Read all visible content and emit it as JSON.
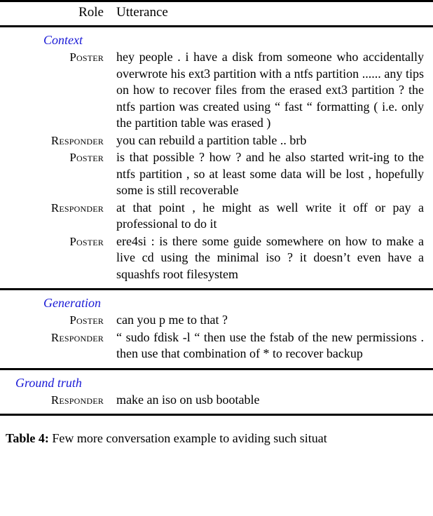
{
  "table": {
    "headers": {
      "role": "Role",
      "utterance": "Utterance"
    },
    "accent_color": "#1a1ad6",
    "sections": [
      {
        "label": "Context",
        "rows": [
          {
            "role": "Poster",
            "text": "hey people .  i have a disk from someone who accidentally overwrote his ext3 partition with a ntfs partition ...... any tips on how to recover files from the erased ext3 partition ?  the ntfs partion was created using “ fast “ formatting ( i.e.  only the partition table was erased )"
          },
          {
            "role": "Responder",
            "text": "you can rebuild a partition table .. brb"
          },
          {
            "role": "Poster",
            "text": "is that possible ?  how ?  and he also started writ-ing to the ntfs partition , so at least some data will be lost , hopefully some is still recoverable"
          },
          {
            "role": "Responder",
            "text": "at that point , he might as well write it off or pay a professional to do it"
          },
          {
            "role": "Poster",
            "text": "ere4si : is there some guide somewhere on how to make a live cd using the minimal iso ? it doesn’t even have a squashfs root filesystem"
          }
        ]
      },
      {
        "label": "Generation",
        "rows": [
          {
            "role": "Poster",
            "text": "can you p me to that ?"
          },
          {
            "role": "Responder",
            "text": "“ sudo fdisk -l “ then use the fstab of the new permissions .  then use that combination of * to recover backup"
          }
        ]
      },
      {
        "label": "Ground truth",
        "rows": [
          {
            "role": "Responder",
            "text": "make an iso on usb bootable"
          }
        ]
      }
    ]
  },
  "caption": {
    "number": "Table 4:",
    "text": "Few more conversation example to aviding such situat"
  }
}
